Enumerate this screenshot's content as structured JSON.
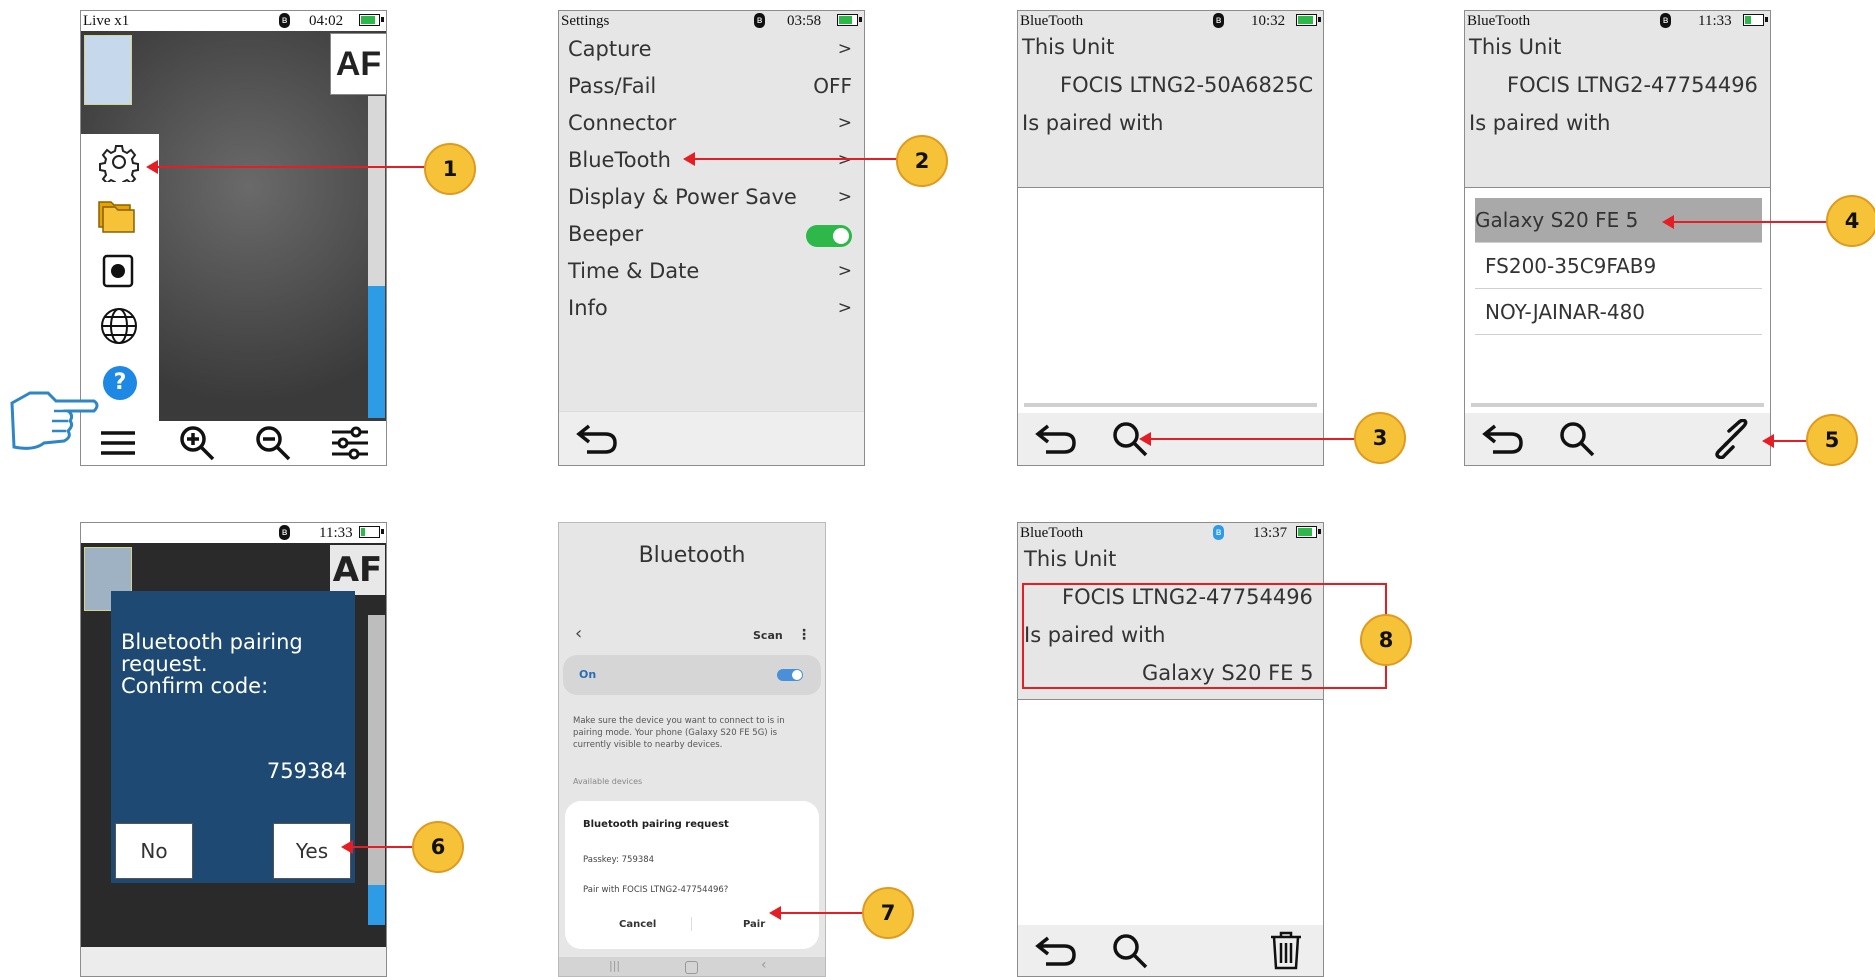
{
  "colors": {
    "accent_red": "#e51e25",
    "marker_fill": "#f6c238",
    "toggle_green": "#2fb84a",
    "dialog_blue": "#1d4973",
    "phone_blue": "#4a90d9"
  },
  "step_markers": [
    "1",
    "2",
    "3",
    "4",
    "5",
    "6",
    "7",
    "8"
  ],
  "panel1": {
    "status_title": "Live x1",
    "time": "04:02",
    "af_label": "AF",
    "side_icons": [
      "gear-icon",
      "folder-icon",
      "record-icon",
      "globe-icon",
      "help-icon"
    ],
    "bottom_icons": [
      "menu-icon",
      "zoom-in-icon",
      "zoom-out-icon",
      "sliders-icon"
    ],
    "help_glyph": "?"
  },
  "panel2": {
    "status_title": "Settings",
    "time": "03:58",
    "items": [
      {
        "label": "Capture",
        "value": ">"
      },
      {
        "label": "Pass/Fail",
        "value": "OFF"
      },
      {
        "label": "Connector",
        "value": ">"
      },
      {
        "label": "BlueTooth",
        "value": ">"
      },
      {
        "label": "Display & Power Save",
        "value": ">"
      },
      {
        "label": "Beeper",
        "value": ""
      },
      {
        "label": "Time & Date",
        "value": ">"
      },
      {
        "label": "Info",
        "value": ">"
      }
    ],
    "beeper_on": true
  },
  "panel3": {
    "status_title": "BlueTooth",
    "time": "10:32",
    "this_unit": "This Unit",
    "unit_name": "FOCIS LTNG2-50A6825C",
    "paired_with": "Is paired with"
  },
  "panel4": {
    "status_title": "BlueTooth",
    "time": "11:33",
    "this_unit": "This Unit",
    "unit_name": "FOCIS LTNG2-47754496",
    "paired_with": "Is paired with",
    "devices": [
      "Galaxy S20 FE 5",
      "FS200-35C9FAB9",
      "NOY-JAINAR-480"
    ]
  },
  "panel5": {
    "time": "11:33",
    "af_label": "AF",
    "dialog_text_1": "Bluetooth pairing",
    "dialog_text_2": "request.",
    "dialog_text_3": "Confirm code:",
    "code": "759384",
    "no_label": "No",
    "yes_label": "Yes"
  },
  "panel6": {
    "title": "Bluetooth",
    "scan_label": "Scan",
    "on_label": "On",
    "info_text_1": "Make sure the device you want to connect to is in",
    "info_text_2": "pairing mode. Your phone (Galaxy S20 FE 5G) is",
    "info_text_3": "currently visible to nearby devices.",
    "available_devices": "Available devices",
    "dialog_title": "Bluetooth pairing request",
    "passkey": "Passkey: 759384",
    "pair_with": "Pair with FOCIS LTNG2-47754496?",
    "cancel_label": "Cancel",
    "pair_label": "Pair"
  },
  "panel7": {
    "status_title": "BlueTooth",
    "time": "13:37",
    "this_unit": "This Unit",
    "unit_name": "FOCIS LTNG2-47754496",
    "paired_with": "Is paired with",
    "paired_device": "Galaxy S20 FE 5"
  }
}
